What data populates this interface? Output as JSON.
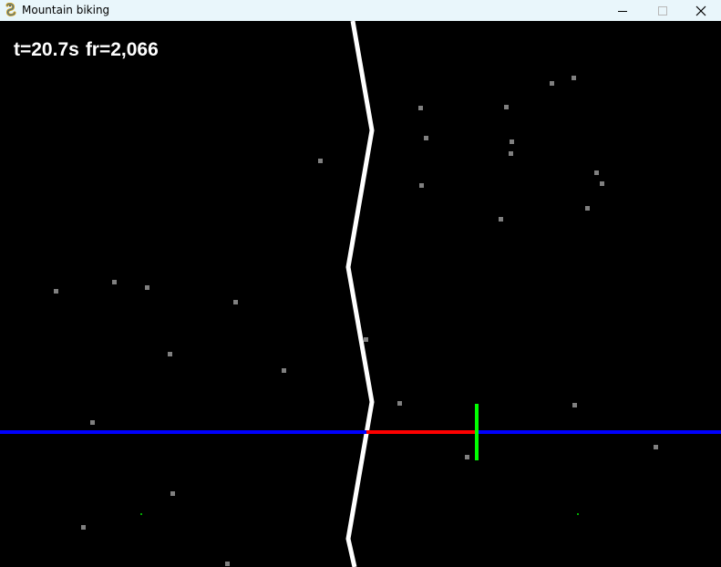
{
  "window": {
    "title": "Mountain biking",
    "app_icon": "pygame-snake-icon",
    "controls": [
      "minimize-icon",
      "maximize-icon",
      "close-icon"
    ]
  },
  "hud": {
    "time_text": "t=20.7s",
    "frame_text": "fr=2,066"
  },
  "scene": {
    "background": "#000000",
    "trail_color": "#ffffff",
    "horizon_color": "#0000ff",
    "offset_color": "#ff0000",
    "rider_marker_color": "#00ff00",
    "dust_color": "#808080"
  }
}
